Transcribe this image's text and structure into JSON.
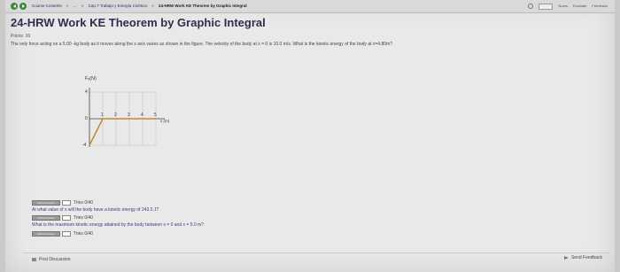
{
  "breadcrumb": {
    "items": [
      "Course Contents",
      "»",
      "...",
      "»",
      "Cap.7 Trabajo y Energía Cinética",
      "»"
    ],
    "current": "24-HRW Work KE Theorem by Graphic Integral"
  },
  "topbar": {
    "right_labels": [
      "Timer",
      "Notes",
      "Evaluate",
      "Feedback"
    ]
  },
  "title": "24-HRW Work KE Theorem by Graphic Integral",
  "points": "Points: 30",
  "problem_text": "The only force acting on a 5.00 -kg body as it moves along the x axis varies as shown in the figure. The velocity of the body at x = 0 is 10.0 m/s. What is the kinetic energy of the body at x=4.80m?",
  "figure": {
    "y_axis_label": "Fₓ(N)",
    "x_axis_label": "x (m)",
    "y_ticks": [
      "4",
      "0",
      "-4"
    ],
    "x_ticks": [
      "1",
      "2",
      "3",
      "4",
      "5"
    ]
  },
  "chart_data": {
    "type": "line",
    "xlabel": "x (m)",
    "ylabel": "Fₓ(N)",
    "x": [
      0,
      1,
      5
    ],
    "y": [
      -4,
      0,
      0
    ],
    "xlim": [
      0,
      5
    ],
    "ylim": [
      -4,
      4
    ],
    "grid": true
  },
  "parts": [
    {
      "button_label": "Submit Answer",
      "tries": "Tries 0/40",
      "question": "At what value of x will the body have a kinetic energy of 243.5 J?"
    },
    {
      "button_label": "Submit Answer",
      "tries": "Tries 0/40",
      "question": "What is the maximum kinetic energy attained by the body between x = 0 and x = 5.0 m?"
    },
    {
      "button_label": "Submit Answer",
      "tries": "Tries 0/40"
    }
  ],
  "footer": {
    "post_discussion": "Post Discussion",
    "send_feedback": "Send Feedback"
  }
}
